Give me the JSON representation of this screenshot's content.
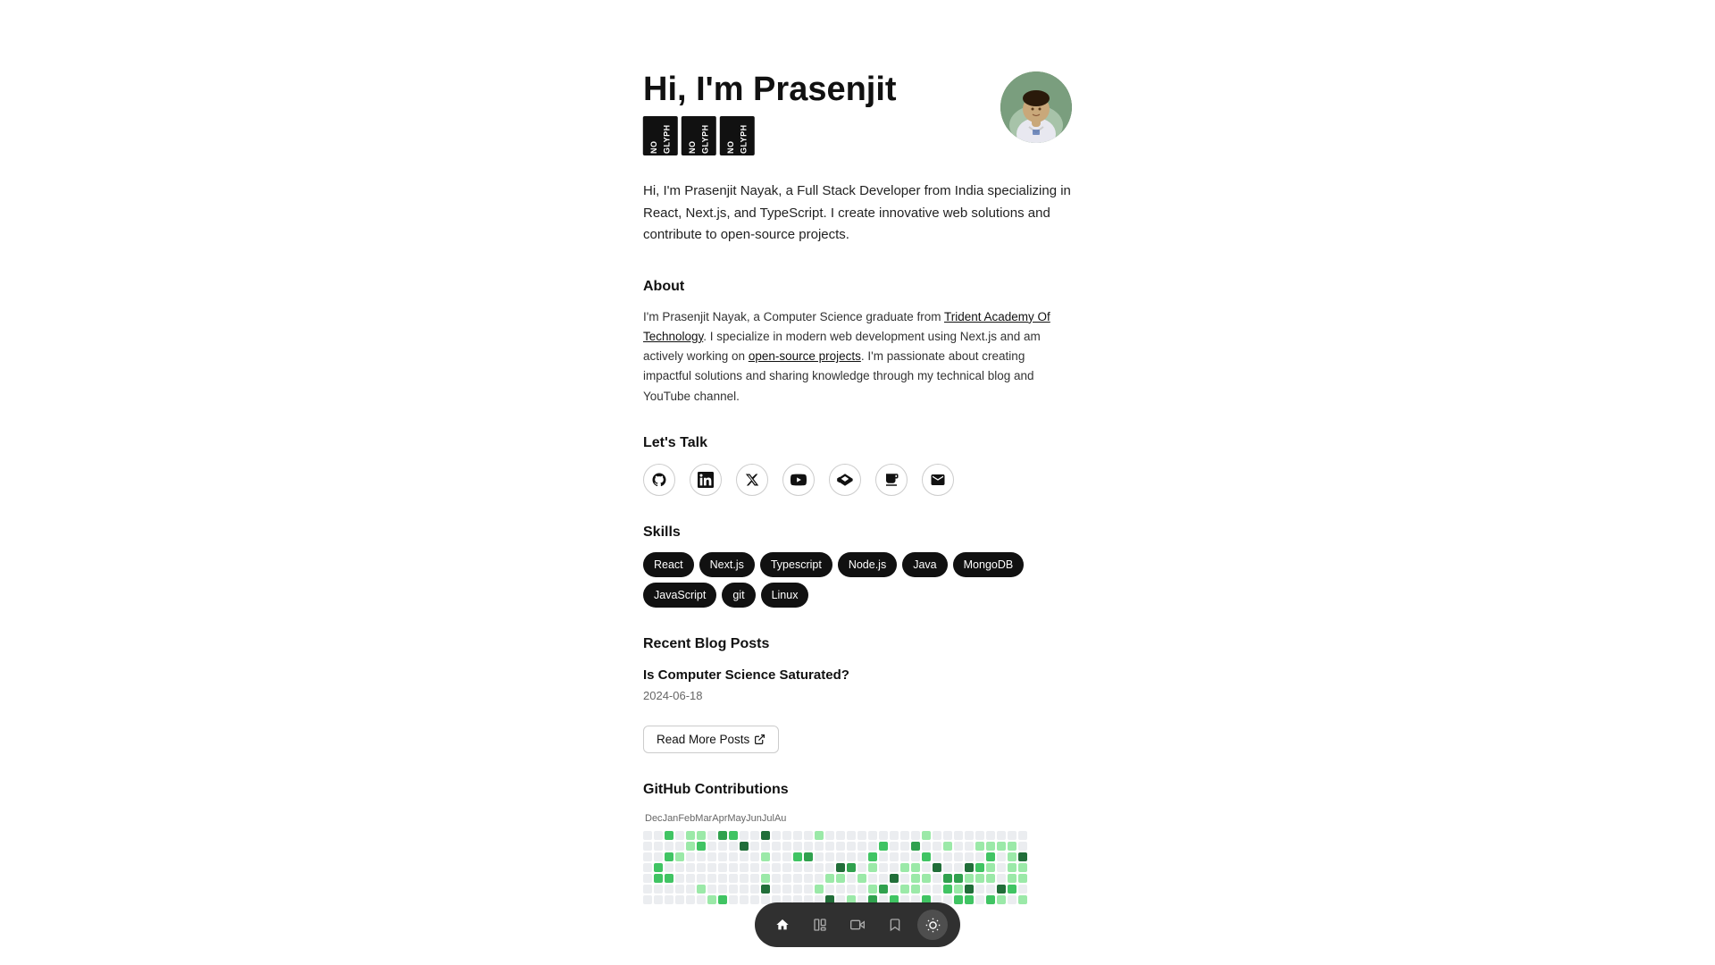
{
  "header": {
    "greeting": "Hi, I'm Prasenjit",
    "avatar_alt": "Prasenjit Nayak profile photo",
    "badge_labels": [
      "NO GLYPH",
      "NO GLYPH",
      "NO GLYPH"
    ]
  },
  "bio": {
    "text": "Hi, I'm Prasenjit Nayak, a Full Stack Developer from India specializing in React, Next.js, and TypeScript. I create innovative web solutions and contribute to open-source projects."
  },
  "about": {
    "title": "About",
    "text_parts": [
      "I'm Prasenjit Nayak, a Computer Science graduate from ",
      "Trident Academy Of Technology",
      ". I specialize in modern web development using Next.js and am actively working on ",
      "open-source projects",
      ". I'm passionate about creating impactful solutions and sharing knowledge through my technical blog and YouTube channel."
    ],
    "link1": "Trident Academy Of Technology",
    "link2": "open-source projects"
  },
  "lets_talk": {
    "title": "Let's Talk",
    "icons": [
      {
        "name": "github-icon",
        "symbol": "⊙",
        "label": "GitHub"
      },
      {
        "name": "linkedin-icon",
        "symbol": "in",
        "label": "LinkedIn"
      },
      {
        "name": "twitter-x-icon",
        "symbol": "✕",
        "label": "Twitter/X"
      },
      {
        "name": "youtube-icon",
        "symbol": "▶",
        "label": "YouTube"
      },
      {
        "name": "codepen-icon",
        "symbol": "◈",
        "label": "CodePen"
      },
      {
        "name": "coffee-icon",
        "symbol": "☕",
        "label": "Buy me a coffee"
      },
      {
        "name": "email-icon",
        "symbol": "✉",
        "label": "Email"
      }
    ]
  },
  "skills": {
    "title": "Skills",
    "items": [
      "React",
      "Next.js",
      "Typescript",
      "Node.js",
      "Java",
      "MongoDB",
      "JavaScript",
      "git",
      "Linux"
    ]
  },
  "blog": {
    "title": "Recent Blog Posts",
    "posts": [
      {
        "title": "Is Computer Science Saturated?",
        "date": "2024-06-18"
      }
    ],
    "read_more_label": "Read More Posts"
  },
  "github": {
    "title": "GitHub Contributions",
    "months": [
      "Dec",
      "Jan",
      "Feb",
      "Mar",
      "Apr",
      "May",
      "Jun",
      "Jul",
      "Au"
    ],
    "colors": {
      "empty": "#ebedf0",
      "level1": "#9be9a8",
      "level2": "#40c463",
      "level3": "#30a14e",
      "level4": "#216e39"
    }
  },
  "toolbar": {
    "buttons": [
      {
        "name": "home-toolbar-btn",
        "icon": "⌂",
        "label": "Home"
      },
      {
        "name": "layout-toolbar-btn",
        "icon": "▦",
        "label": "Layout"
      },
      {
        "name": "video-toolbar-btn",
        "icon": "▶",
        "label": "Video"
      },
      {
        "name": "bookmark-toolbar-btn",
        "icon": "⚑",
        "label": "Bookmark"
      },
      {
        "name": "theme-toolbar-btn",
        "icon": "☀",
        "label": "Theme",
        "active": true
      }
    ]
  }
}
